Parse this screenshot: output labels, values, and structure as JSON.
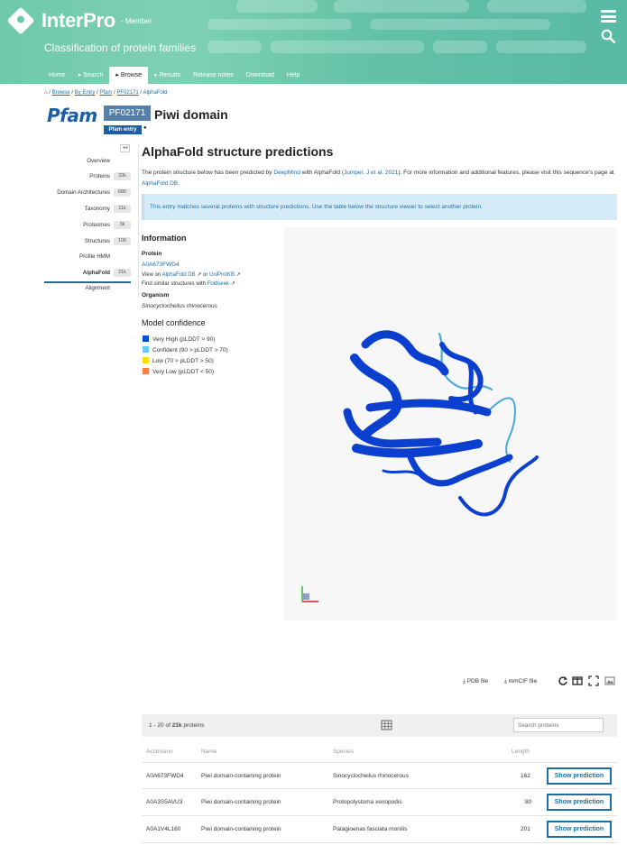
{
  "header": {
    "brand": "InterPro",
    "member": "- Member",
    "tagline": "Classification of protein families",
    "tabs": [
      "Home",
      "Search",
      "Browse",
      "Results",
      "Release notes",
      "Download",
      "Help"
    ],
    "active_tab": "Browse"
  },
  "breadcrumb": {
    "home_sep": "/",
    "items": [
      "Browse",
      "By Entry",
      "Pfam",
      "PF02171"
    ],
    "current": "AlphaFold"
  },
  "entry": {
    "db_logo": "Pfam",
    "accession": "PF02171",
    "title": "Piwi domain",
    "badge": "Pfam entry"
  },
  "sidebar": {
    "items": [
      {
        "label": "Overview",
        "count": ""
      },
      {
        "label": "Proteins",
        "count": "33k"
      },
      {
        "label": "Domain Architectures",
        "count": "685"
      },
      {
        "label": "Taxonomy",
        "count": "11k"
      },
      {
        "label": "Proteomes",
        "count": "3k"
      },
      {
        "label": "Structures",
        "count": "106"
      },
      {
        "label": "Profile HMM",
        "count": ""
      },
      {
        "label": "AlphaFold",
        "count": "21k"
      },
      {
        "label": "Alignment",
        "count": ""
      }
    ],
    "active": "AlphaFold"
  },
  "main": {
    "title": "AlphaFold structure predictions",
    "intro_1": "The protein structure below has been predicted by ",
    "link_deepmind": "DeepMind",
    "intro_2": " with AlphaFold (",
    "link_paper": "Jumper, J et al. 2021",
    "intro_3": "). For more information and additional features, please visit this sequence's page at ",
    "link_afdb": "AlphaFold DB",
    "intro_4": ".",
    "callout": "This entry matches several proteins with structure predictions. Use the table below the structure viewer to select another protein."
  },
  "info": {
    "heading": "Information",
    "protein_label": "Protein",
    "protein_acc": "A0A673FWD4",
    "view_on": "View on",
    "view_afdb": "AlphaFold DB",
    "or": "or",
    "view_uniprot": "UniProtKB",
    "find_similar": "Find similar structures with",
    "foldseek": "Foldseek",
    "organism_label": "Organism",
    "organism": "Sinocyclocheilus rhinocerous",
    "confidence_heading": "Model confidence",
    "legend": [
      {
        "label": "Very High (pLDDT > 90)",
        "color": "#0053d6"
      },
      {
        "label": "Confident (90 > pLDDT > 70)",
        "color": "#65cbf3"
      },
      {
        "label": "Low (70 > pLDDT > 50)",
        "color": "#ffdb13"
      },
      {
        "label": "Very Low (pLDDT < 50)",
        "color": "#ff7d45"
      }
    ]
  },
  "toolbar": {
    "pdb": "PDB file",
    "mmcif": "mmCIF file"
  },
  "table": {
    "range_start": "1",
    "range_end": "20",
    "total": "21k",
    "of": "of",
    "unit": "proteins",
    "search_placeholder": "Search proteins",
    "headers": [
      "Accession",
      "Name",
      "Species",
      "Length"
    ],
    "rows": [
      {
        "accession": "A0A673FWD4",
        "name": "Piwi domain-containing protein",
        "species": "Sinocyclocheilus rhinocerous",
        "length": "162",
        "action": "Show prediction"
      },
      {
        "accession": "A0A3S5AVU3",
        "name": "Piwi domain-containing protein",
        "species": "Protopolystoma xenopodis",
        "length": "80",
        "action": "Show prediction"
      },
      {
        "accession": "A0A1V4L160",
        "name": "Piwi domain-containing protein",
        "species": "Patagioenas fasciata monilis",
        "length": "201",
        "action": "Show prediction"
      }
    ]
  }
}
